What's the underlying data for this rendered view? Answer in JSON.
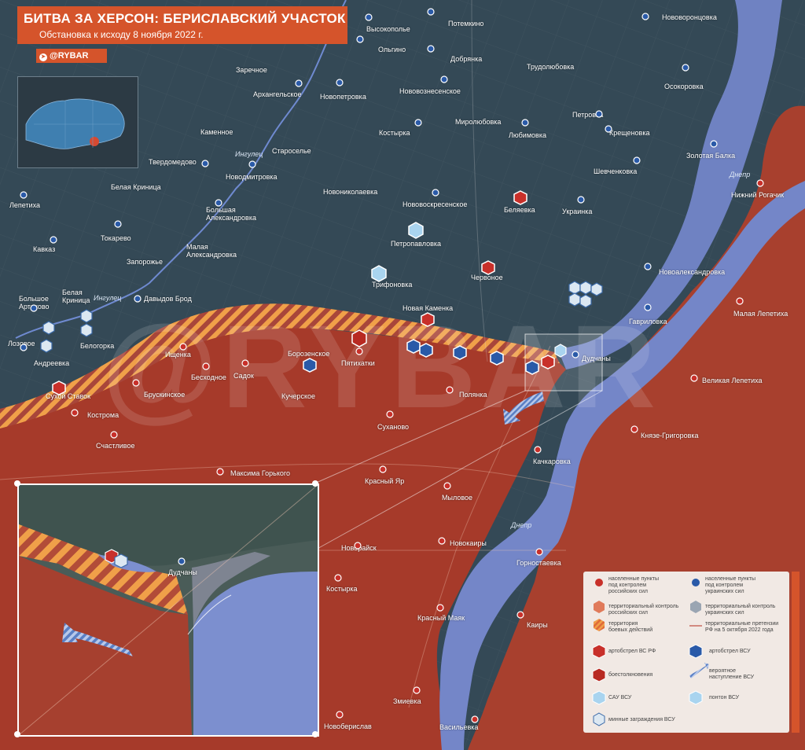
{
  "header": {
    "title": "БИТВА ЗА ХЕРСОН: БЕРИСЛАВСКИЙ УЧАСТОК",
    "subtitle": "Обстановка к исходу 8 ноября 2022 г.",
    "brand": "@RYBAR",
    "telegram_icon": "telegram-icon"
  },
  "watermark": "@RYBAR",
  "colors": {
    "ukr_territory": "#3a4e5c",
    "rus_territory": "#a63a2a",
    "contested": "#f0a049",
    "water": "#7a8fcc",
    "accent": "#d5542b",
    "ukr_marker": "#2a5aa8",
    "rus_marker": "#c8302a"
  },
  "rivers": [
    "Ингулец",
    "Ингулец",
    "Днепр",
    "Днепр"
  ],
  "places_ukr": [
    "Высокополье",
    "Потемкино",
    "Нововоронцовка",
    "Ольгино",
    "Добрянка",
    "Трудолюбовка",
    "Заречное",
    "Архангельское",
    "Новопетровка",
    "Нововознесенское",
    "Осокоровка",
    "Костырка",
    "Миролюбовка",
    "Петровка",
    "Каменное",
    "Староселье",
    "Любимовка",
    "Крещеновка",
    "Золотая Балка",
    "Твердомедово",
    "Новодмитровка",
    "Шевченковка",
    "Белая Криница",
    "Новониколаевка",
    "Нововоскресенское",
    "Украинка",
    "Лепетиха",
    "Большая Александровка",
    "Кавказ",
    "Токарево",
    "Петропавловка",
    "Запорожье",
    "Малая Александровка",
    "Новоалександровка",
    "Трифоновка",
    "Большое Артаково",
    "Белая Криница",
    "Давыдов Брод",
    "Новая Каменка",
    "Гавриловка",
    "Лозовое",
    "Белогорка",
    "Андреевка",
    "Борозенское",
    "Дудчаны"
  ],
  "places_rus": [
    "Нижний Рогачик",
    "Беляевка",
    "Червоное",
    "Малая Лепетиха",
    "Пятихатки",
    "Ищенка",
    "Бесходное",
    "Садок",
    "Сухой Ставок",
    "Брускинское",
    "Кучерское",
    "Полянка",
    "Великая Лепетиха",
    "Кострома",
    "Суханово",
    "Князе-Григоровка",
    "Счастливое",
    "Качкаровка",
    "Максима Горького",
    "Красный Яр",
    "Мыловое",
    "Новорайск",
    "Новокаиры",
    "Горностаевка",
    "Костырка",
    "Красный Маяк",
    "Каиры",
    "Змиевка",
    "Новоберислав",
    "Васильевка"
  ],
  "inset": {
    "town": "Дудчаны"
  },
  "legend": {
    "items": [
      {
        "icon": "pin-red",
        "label": "населенные пункты\nпод контролем\nроссийских сил"
      },
      {
        "icon": "pin-blue",
        "label": "населенные пункты\nпод контролем\nукраинских сил"
      },
      {
        "icon": "hex-red-fill",
        "label": "территориальный контроль\nроссийских сил"
      },
      {
        "icon": "hex-gray-fill",
        "label": "территориальный контроль\nукраинских сил"
      },
      {
        "icon": "hex-hatched",
        "label": "территория\nбоевых действий"
      },
      {
        "icon": "line-claims",
        "label": "территориальные претензии\nРФ на 5 октября 2022 года"
      },
      {
        "icon": "artillery-red-icon",
        "label": "артобстрел ВС РФ"
      },
      {
        "icon": "artillery-blue-icon",
        "label": "артобстрел ВСУ"
      },
      {
        "icon": "clash-icon",
        "label": "боестолкновения"
      },
      {
        "icon": "advance-arrow-icon",
        "label": "вероятное\nнаступление ВСУ"
      },
      {
        "icon": "sau-icon",
        "label": "САУ ВСУ"
      },
      {
        "icon": "pontoon-icon",
        "label": "понтон ВСУ"
      },
      {
        "icon": "mines-icon",
        "label": "минные заграждения ВСУ"
      }
    ]
  }
}
